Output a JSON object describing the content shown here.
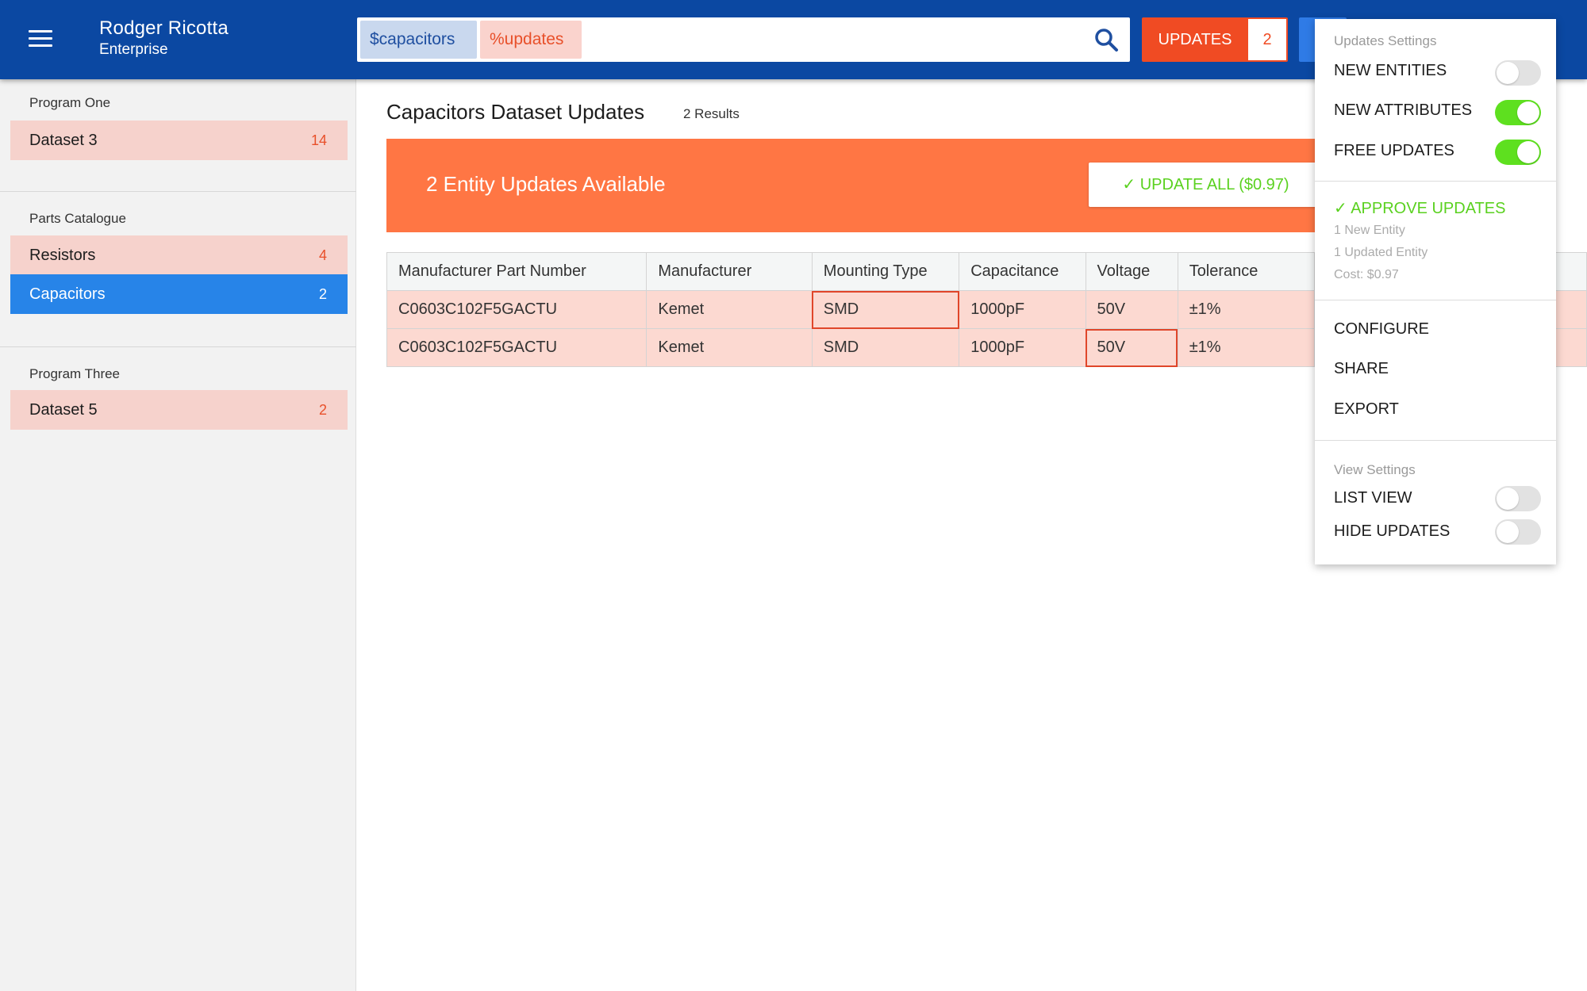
{
  "header": {
    "user_name": "Rodger Ricotta",
    "user_org": "Enterprise",
    "search_chips": [
      "$capacitors",
      "%updates"
    ],
    "updates_label": "UPDATES",
    "updates_count": "2"
  },
  "sidebar": {
    "groups": [
      {
        "heading": "Program One",
        "items": [
          {
            "label": "Dataset 3",
            "count": "14"
          }
        ]
      },
      {
        "heading": "Parts Catalogue",
        "items": [
          {
            "label": "Resistors",
            "count": "4"
          },
          {
            "label": "Capacitors",
            "count": "2",
            "active": true
          }
        ]
      },
      {
        "heading": "Program Three",
        "items": [
          {
            "label": "Dataset 5",
            "count": "2"
          }
        ]
      }
    ]
  },
  "main": {
    "title": "Capacitors Dataset Updates",
    "result_count": "2 Results",
    "banner_text": "2 Entity Updates Available",
    "update_all_label": "✓ UPDATE ALL ($0.97)",
    "table": {
      "columns": [
        "Manufacturer Part Number",
        "Manufacturer",
        "Mounting Type",
        "Capacitance",
        "Voltage",
        "Tolerance",
        ""
      ],
      "rows": [
        [
          "C0603C102F5GACTU",
          "Kemet",
          "SMD",
          "1000pF",
          "50V",
          "±1%",
          ""
        ],
        [
          "C0603C102F5GACTU",
          "Kemet",
          "SMD",
          "1000pF",
          "50V",
          "±1%",
          ""
        ]
      ]
    }
  },
  "menu": {
    "updates_settings_title": "Updates Settings",
    "toggles": [
      {
        "label": "NEW ENTITIES",
        "on": false
      },
      {
        "label": "NEW ATTRIBUTES",
        "on": true
      },
      {
        "label": "FREE UPDATES",
        "on": true
      }
    ],
    "approve_label": "✓ APPROVE UPDATES",
    "approve_details": [
      "1 New Entity",
      "1 Updated Entity",
      "Cost: $0.97"
    ],
    "actions": [
      "CONFIGURE",
      "SHARE",
      "EXPORT"
    ],
    "view_settings_title": "View Settings",
    "view_toggles": [
      {
        "label": "LIST VIEW",
        "on": false
      },
      {
        "label": "HIDE UPDATES",
        "on": false
      }
    ]
  },
  "colors": {
    "header": "#0b48a2",
    "accent_orange": "#ff7644",
    "updates_red": "#f04b23",
    "active_blue": "#2784e8",
    "toggle_green": "#5ee01f",
    "row_highlight": "#fcd9d1"
  }
}
